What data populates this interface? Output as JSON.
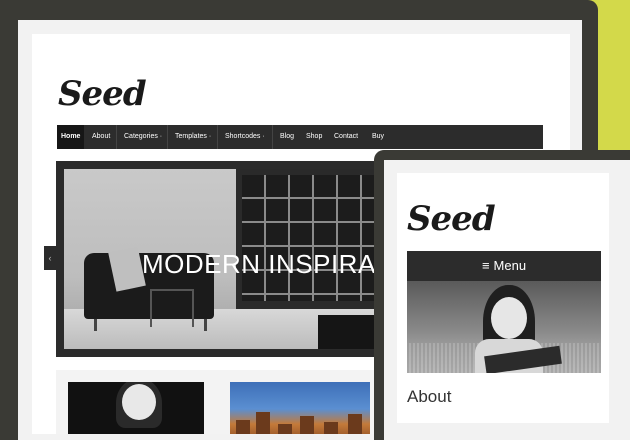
{
  "desktop": {
    "logo_text": "Seed",
    "nav": [
      {
        "label": "Home"
      },
      {
        "label": "About"
      },
      {
        "label": "Categories ·"
      },
      {
        "label": "Templates ·"
      },
      {
        "label": "Shortcodes ·"
      },
      {
        "label": "Blog"
      },
      {
        "label": "Shop"
      },
      {
        "label": "Contact"
      },
      {
        "label": "Buy"
      }
    ],
    "slider": {
      "caption": "MODERN INSPIRA",
      "prev_icon": "chevron-left-icon",
      "prev_glyph": "‹"
    }
  },
  "mobile": {
    "logo_text": "Seed",
    "menu_label": "Menu",
    "menu_icon": "hamburger-icon",
    "menu_glyph": "≡",
    "section_heading": "About"
  },
  "colors": {
    "background": "#d3d94a",
    "device_frame": "#3a3a35",
    "nav_bar": "#2c2c2c"
  }
}
